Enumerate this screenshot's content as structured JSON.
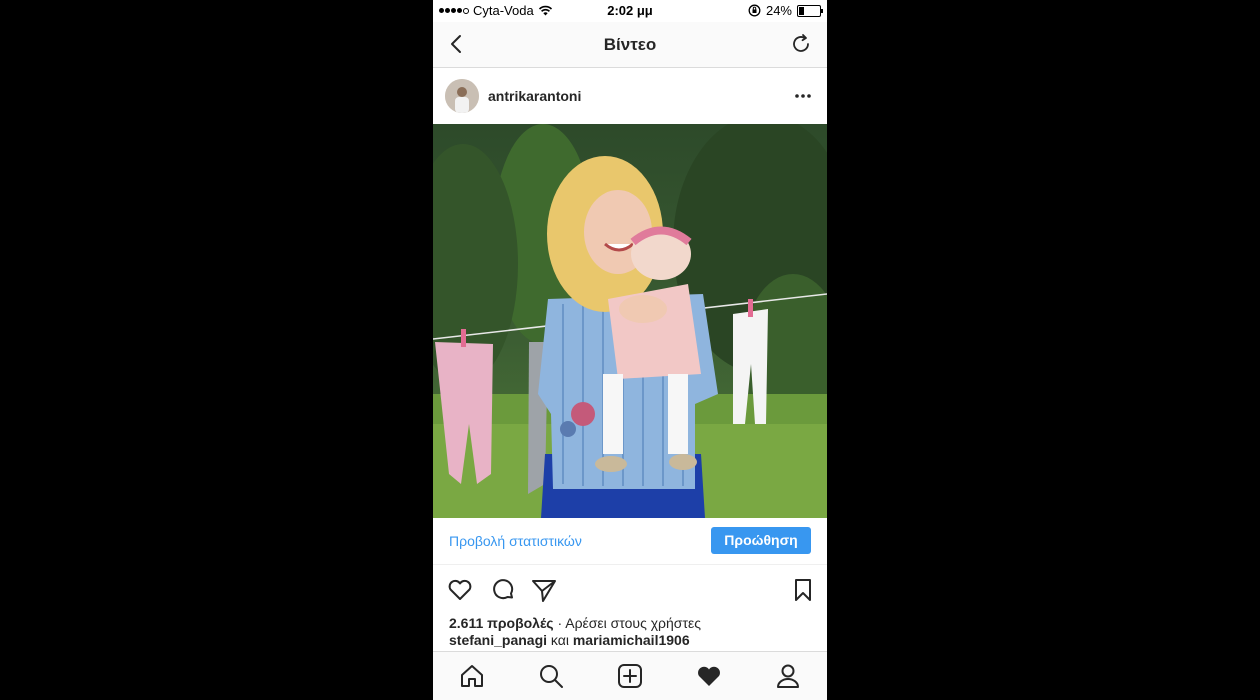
{
  "status_bar": {
    "carrier": "Cyta-Voda",
    "time": "2:02 μμ",
    "battery": "24%",
    "battery_level": 0.24,
    "signal_bars_filled": 4,
    "signal_bars_total": 5
  },
  "nav": {
    "title": "Βίντεο",
    "back_icon": "chevron-left-icon",
    "refresh_icon": "refresh-icon"
  },
  "post": {
    "username": "antrikarantoni",
    "more_icon": "ellipsis-icon"
  },
  "promo": {
    "stats_label": "Προβολή στατιστικών",
    "promote_label": "Προώθηση"
  },
  "engagement": {
    "views": "2.611 προβολές",
    "liked_by_prefix": "· Αρέσει στους χρήστες",
    "liker1": "stefani_panagi",
    "and": "και",
    "liker2": "mariamichail1906"
  },
  "colors": {
    "accent": "#3897f0",
    "text": "#262626",
    "border": "#dbdbdb"
  },
  "tab_bar": [
    "home-icon",
    "search-icon",
    "add-icon",
    "activity-heart-icon",
    "profile-icon"
  ]
}
